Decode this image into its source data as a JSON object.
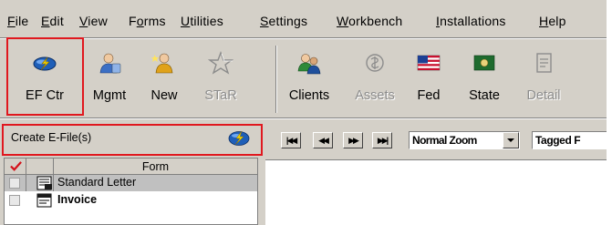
{
  "menu": {
    "items": [
      {
        "mn": "F",
        "rest": "ile"
      },
      {
        "mn": "E",
        "rest": "dit"
      },
      {
        "mn": "V",
        "rest": "iew"
      },
      {
        "pre": "F",
        "mn": "o",
        "rest": "rms"
      },
      {
        "mn": "U",
        "rest": "tilities"
      },
      {
        "mn": "S",
        "rest": "ettings"
      },
      {
        "mn": "W",
        "rest": "orkbench"
      },
      {
        "mn": "I",
        "rest": "nstallations"
      },
      {
        "mn": "H",
        "rest": "elp"
      }
    ]
  },
  "toolbar": {
    "buttons": [
      {
        "label": "EF Ctr",
        "icon": "lightning-disc-icon",
        "enabled": true,
        "highlighted": true
      },
      {
        "label": "Mgmt",
        "icon": "user-icon",
        "enabled": true
      },
      {
        "label": "New",
        "icon": "new-user-icon",
        "enabled": true
      },
      {
        "label": "STaR",
        "icon": "star-icon",
        "enabled": false
      },
      {
        "label": "Clients",
        "icon": "clients-icon",
        "enabled": true
      },
      {
        "label": "Assets",
        "icon": "assets-icon",
        "enabled": false
      },
      {
        "label": "Fed",
        "icon": "us-flag-icon",
        "enabled": true
      },
      {
        "label": "State",
        "icon": "state-flag-icon",
        "enabled": true
      },
      {
        "label": "Detail",
        "icon": "detail-icon",
        "enabled": false
      }
    ]
  },
  "efile_panel": {
    "header": "Create E-File(s)",
    "header_icon": "lightning-disc-icon",
    "grid": {
      "column_header": "Form",
      "rows": [
        {
          "label": "Standard Letter",
          "icon": "letter-form-icon",
          "selected": true
        },
        {
          "label": "Invoice",
          "icon": "invoice-form-icon",
          "bold": true
        }
      ]
    }
  },
  "viewer": {
    "nav": [
      "first-page-icon",
      "prev-page-icon",
      "next-page-icon",
      "last-page-icon"
    ],
    "zoom_value": "Normal Zoom",
    "tagged_value": "Tagged F"
  },
  "colors": {
    "highlight": "#e0181f",
    "chrome": "#d4d0c8",
    "selected_row": "#c0c0c0"
  }
}
